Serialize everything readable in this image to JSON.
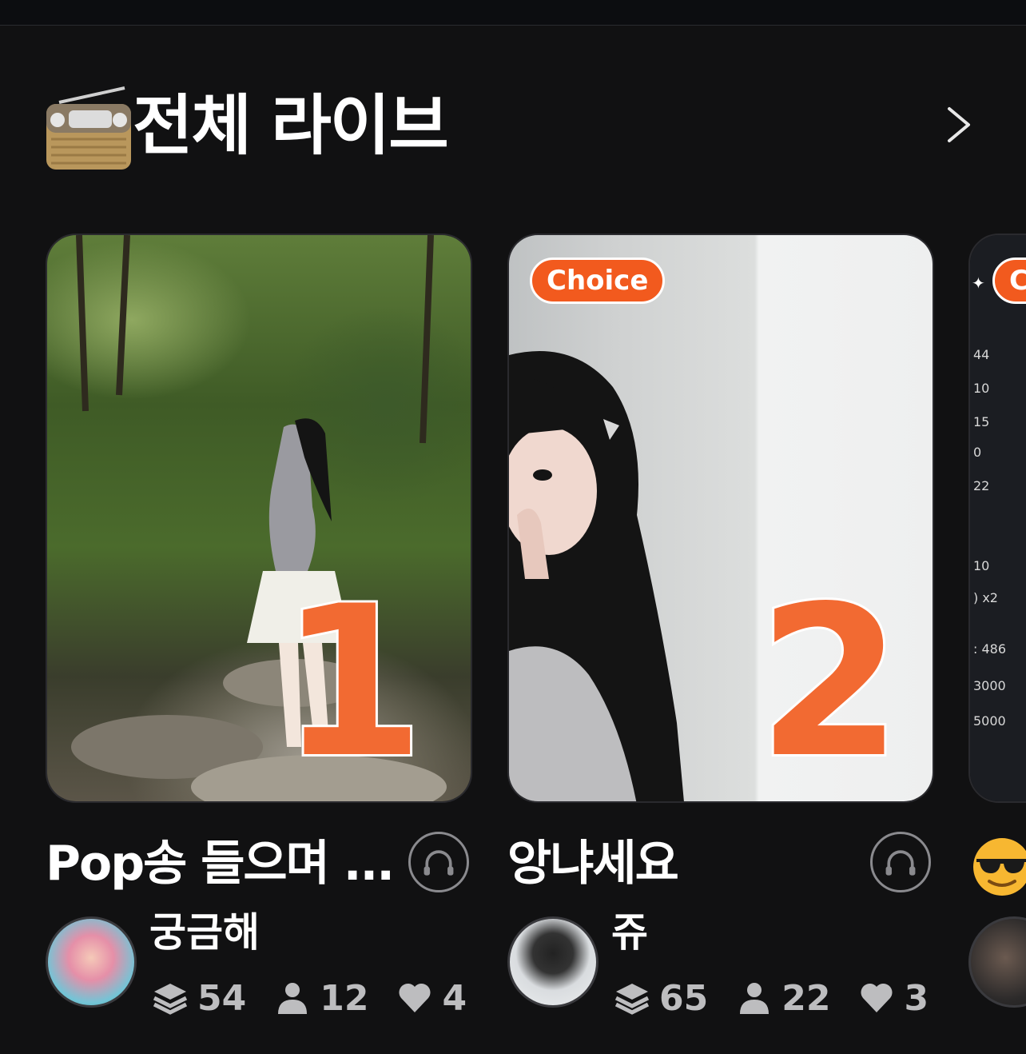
{
  "section": {
    "title": "전체 라이브",
    "icon": "radio-icon",
    "more_icon": "chevron-right-icon"
  },
  "colors": {
    "background": "#111112",
    "accent": "#f25a1e",
    "stat_text": "#bdbdbf"
  },
  "cards": [
    {
      "rank": "1",
      "title": "Pop송 들으며 ...",
      "nickname": "궁금해",
      "stats": {
        "plays": "54",
        "listeners": "12",
        "likes": "4"
      }
    },
    {
      "rank": "2",
      "badge": "Choice",
      "title": "앙냐세요",
      "nickname": "쥬",
      "stats": {
        "plays": "65",
        "listeners": "22",
        "likes": "3"
      }
    },
    {
      "badge": "Cl",
      "side_values": [
        "44",
        "10",
        "15",
        "0",
        "22",
        "10",
        ") x2",
        ": 486",
        "3000",
        "5000"
      ]
    }
  ]
}
